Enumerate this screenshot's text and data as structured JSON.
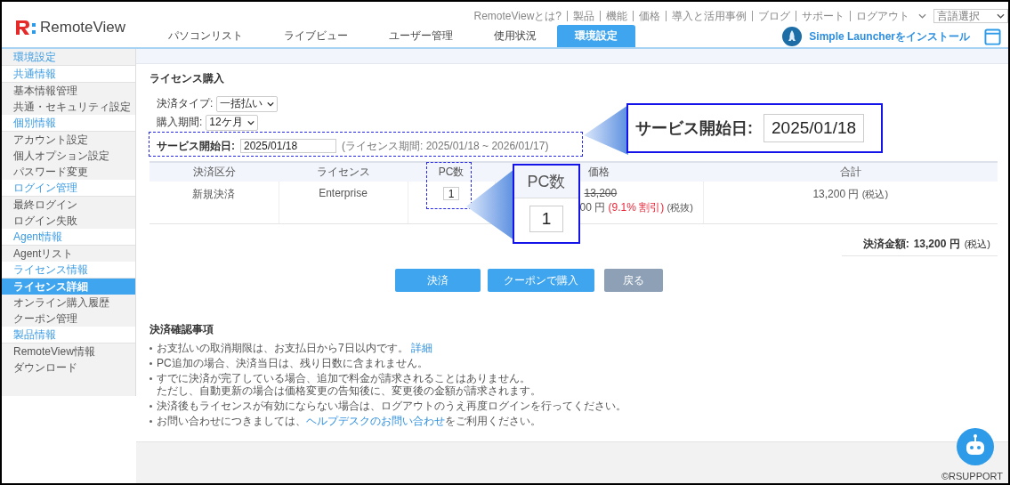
{
  "header": {
    "logo_text": "RemoteView",
    "top_links": [
      "RemoteViewとは?",
      "製品",
      "機能",
      "価格",
      "導入と活用事例",
      "ブログ",
      "サポート",
      "ログアウト"
    ],
    "language_select": "言語選択",
    "tabs": [
      {
        "label": "パソコンリスト",
        "selected": false
      },
      {
        "label": "ライブビュー",
        "selected": false
      },
      {
        "label": "ユーザー管理",
        "selected": false
      },
      {
        "label": "使用状況",
        "selected": false
      },
      {
        "label": "環境設定",
        "selected": true
      }
    ],
    "launcher_link": "Simple Launcherをインストール"
  },
  "sidebar": {
    "title": "環境設定",
    "groups": [
      {
        "title": "共通情報",
        "items": [
          {
            "label": "基本情報管理",
            "selected": false
          },
          {
            "label": "共通・セキュリティ設定",
            "selected": false
          }
        ]
      },
      {
        "title": "個別情報",
        "items": [
          {
            "label": "アカウント設定",
            "selected": false
          },
          {
            "label": "個人オプション設定",
            "selected": false
          },
          {
            "label": "パスワード変更",
            "selected": false
          }
        ]
      },
      {
        "title": "ログイン管理",
        "items": [
          {
            "label": "最終ログイン",
            "selected": false
          },
          {
            "label": "ログイン失敗",
            "selected": false
          }
        ]
      },
      {
        "title": "Agent情報",
        "items": [
          {
            "label": "Agentリスト",
            "selected": false
          }
        ]
      },
      {
        "title": "ライセンス情報",
        "items": [
          {
            "label": "ライセンス詳細",
            "selected": true
          },
          {
            "label": "オンライン購入履歴",
            "selected": false
          },
          {
            "label": "クーポン管理",
            "selected": false
          }
        ]
      },
      {
        "title": "製品情報",
        "items": [
          {
            "label": "RemoteView情報",
            "selected": false
          },
          {
            "label": "ダウンロード",
            "selected": false
          }
        ]
      }
    ]
  },
  "content": {
    "title": "ライセンス購入",
    "payment_type": {
      "label": "決済タイプ:",
      "value": "一括払い"
    },
    "period": {
      "label": "購入期間:",
      "value": "12ケ月"
    },
    "service_start": {
      "label": "サービス開始日:",
      "value": "2025/01/18",
      "note": "(ライセンス期間: 2025/01/18 ~ 2026/01/17)"
    },
    "table": {
      "columns": [
        "決済区分",
        "ライセンス",
        "PC数",
        "価格",
        "合計"
      ],
      "row": {
        "type": "新規決済",
        "license": "Enterprise",
        "pc_count": "1",
        "price_original": "13,200",
        "price": "00 円",
        "discount": "(9.1% 割引)",
        "price_tax": "(税抜)",
        "total": "13,200 円",
        "total_tax": "(税込)"
      }
    },
    "summary": {
      "label": "決済金額:",
      "amount": "13,200 円",
      "tax": "(税込)"
    },
    "buttons": [
      {
        "label": "決済",
        "kind": "primary"
      },
      {
        "label": "クーポンで購入",
        "kind": "primary"
      },
      {
        "label": "戻る",
        "kind": "secondary"
      }
    ],
    "notes_title": "決済確認事項",
    "notes": [
      {
        "parts": [
          {
            "kind": "text",
            "text": "お支払いの取消期限は、お支払日から7日以内です。 "
          },
          {
            "kind": "link",
            "text": "詳細"
          }
        ]
      },
      {
        "parts": [
          {
            "kind": "text",
            "text": "PC追加の場合、決済当日は、残り日数に含まれません。"
          }
        ]
      },
      {
        "parts": [
          {
            "kind": "text",
            "text": "すでに決済が完了している場合、追加で料金が請求されることはありません。"
          },
          {
            "kind": "line",
            "text": "ただし、自動更新の場合は価格変更の告知後に、変更後の金額が請求されます。"
          }
        ]
      },
      {
        "parts": [
          {
            "kind": "text",
            "text": "決済後もライセンスが有効にならない場合は、ログアウトのうえ再度ログインを行ってください。"
          }
        ]
      },
      {
        "parts": [
          {
            "kind": "text",
            "text": "お問い合わせにつきましては、"
          },
          {
            "kind": "link",
            "text": "ヘルプデスクのお問い合わせ"
          },
          {
            "kind": "text",
            "text": "をご利用ください。"
          }
        ]
      }
    ]
  },
  "callouts": [
    {
      "kind": "field",
      "label": "サービス開始日:",
      "value": "2025/01/18"
    },
    {
      "kind": "column",
      "label": "PC数",
      "value": "1"
    }
  ],
  "footer": {
    "copyright": "©RSUPPORT"
  }
}
